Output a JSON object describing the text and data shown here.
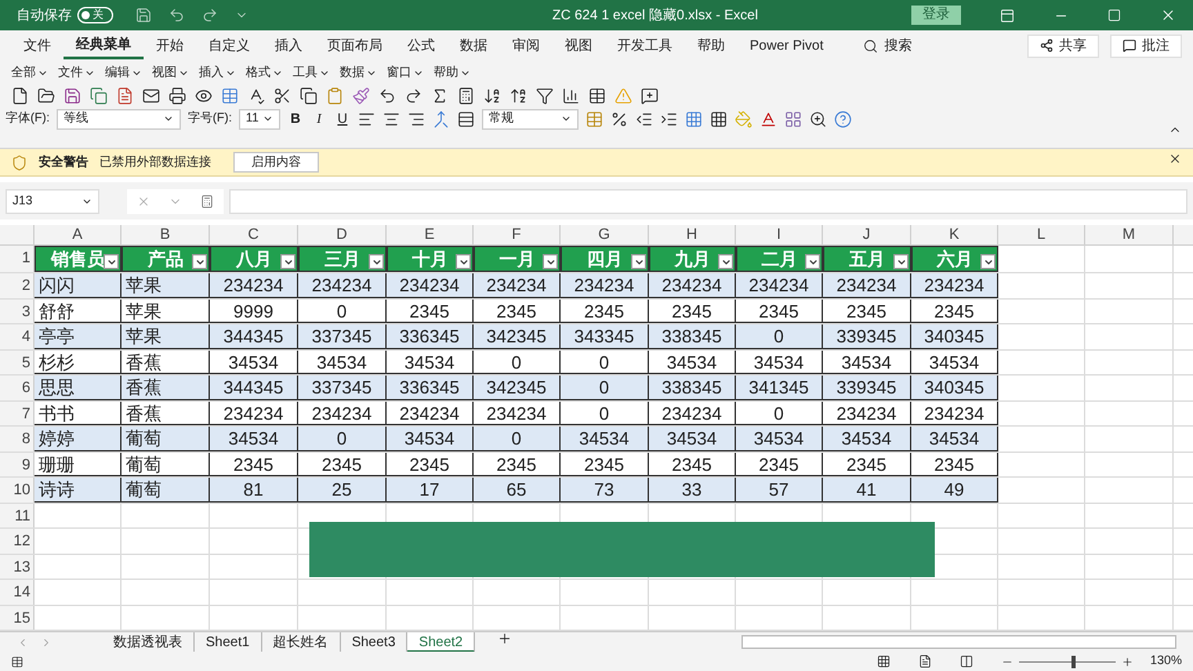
{
  "title_bar": {
    "autosave_label": "自动保存",
    "autosave_toggle": {
      "on": false,
      "label": "关"
    },
    "title": "ZC 624 1 excel 隐藏0.xlsx  -  Excel",
    "login": "登录"
  },
  "ribbon_tabs": [
    {
      "label": "文件",
      "selected": false
    },
    {
      "label": "经典菜单",
      "selected": true
    },
    {
      "label": "开始",
      "selected": false
    },
    {
      "label": "自定义",
      "selected": false
    },
    {
      "label": "插入",
      "selected": false
    },
    {
      "label": "页面布局",
      "selected": false
    },
    {
      "label": "公式",
      "selected": false
    },
    {
      "label": "数据",
      "selected": false
    },
    {
      "label": "审阅",
      "selected": false
    },
    {
      "label": "视图",
      "selected": false
    },
    {
      "label": "开发工具",
      "selected": false
    },
    {
      "label": "帮助",
      "selected": false
    },
    {
      "label": "Power Pivot",
      "selected": false
    }
  ],
  "search": "搜索",
  "share": "共享",
  "comments": "批注",
  "classic_menus": [
    "全部",
    "文件",
    "编辑",
    "视图",
    "插入",
    "格式",
    "工具",
    "数据",
    "窗口",
    "帮助"
  ],
  "font_row": {
    "font_label": "字体(F):",
    "font_value": "等线",
    "size_label": "字号(F):",
    "size_value": "11",
    "format_buttons": [
      "B",
      "I",
      "U"
    ],
    "number_format": "常规"
  },
  "security_bar": {
    "title": "安全警告",
    "message": "已禁用外部数据连接",
    "button": "启用内容"
  },
  "name_box": "J13",
  "columns": [
    "A",
    "B",
    "C",
    "D",
    "E",
    "F",
    "G",
    "H",
    "I",
    "J",
    "K",
    "L",
    "M"
  ],
  "row_numbers": [
    "1",
    "2",
    "3",
    "4",
    "5",
    "6",
    "7",
    "8",
    "9",
    "10",
    "11",
    "12",
    "13",
    "14",
    "15"
  ],
  "header": [
    "销售员",
    "产品",
    "八月",
    "三月",
    "十月",
    "一月",
    "四月",
    "九月",
    "二月",
    "五月",
    "六月"
  ],
  "rows": [
    {
      "cells": [
        "闪闪",
        "苹果",
        "234234",
        "234234",
        "234234",
        "234234",
        "234234",
        "234234",
        "234234",
        "234234",
        "234234"
      ]
    },
    {
      "cells": [
        "舒舒",
        "苹果",
        "9999",
        "0",
        "2345",
        "2345",
        "2345",
        "2345",
        "2345",
        "2345",
        "2345"
      ]
    },
    {
      "cells": [
        "亭亭",
        "苹果",
        "344345",
        "337345",
        "336345",
        "342345",
        "343345",
        "338345",
        "0",
        "339345",
        "340345"
      ]
    },
    {
      "cells": [
        "杉杉",
        "香蕉",
        "34534",
        "34534",
        "34534",
        "0",
        "0",
        "34534",
        "34534",
        "34534",
        "34534"
      ]
    },
    {
      "cells": [
        "思思",
        "香蕉",
        "344345",
        "337345",
        "336345",
        "342345",
        "0",
        "338345",
        "341345",
        "339345",
        "340345"
      ]
    },
    {
      "cells": [
        "书书",
        "香蕉",
        "234234",
        "234234",
        "234234",
        "234234",
        "0",
        "234234",
        "0",
        "234234",
        "234234"
      ]
    },
    {
      "cells": [
        "婷婷",
        "葡萄",
        "34534",
        "0",
        "34534",
        "0",
        "34534",
        "34534",
        "34534",
        "34534",
        "34534"
      ]
    },
    {
      "cells": [
        "珊珊",
        "葡萄",
        "2345",
        "2345",
        "2345",
        "2345",
        "2345",
        "2345",
        "2345",
        "2345",
        "2345"
      ]
    },
    {
      "cells": [
        "诗诗",
        "葡萄",
        "81",
        "25",
        "17",
        "65",
        "73",
        "33",
        "57",
        "41",
        "49"
      ]
    }
  ],
  "sheet_tabs": [
    {
      "label": "数据透视表",
      "selected": false
    },
    {
      "label": "Sheet1",
      "selected": false
    },
    {
      "label": "超长姓名",
      "selected": false
    },
    {
      "label": "Sheet3",
      "selected": false
    },
    {
      "label": "Sheet2",
      "selected": true
    }
  ],
  "zoom": {
    "level": 0.55,
    "label": "130%"
  }
}
